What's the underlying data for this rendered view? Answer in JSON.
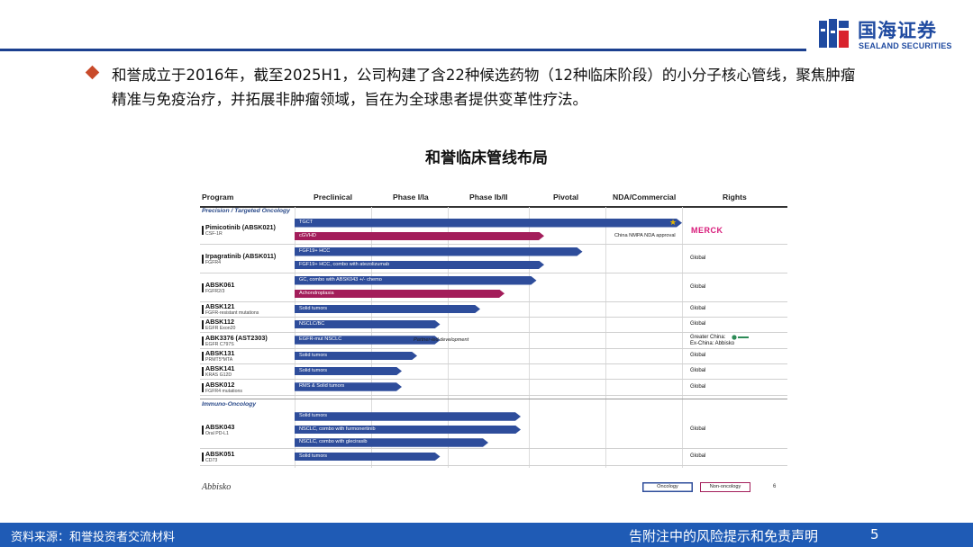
{
  "header": {
    "logo_cn": "国海证券",
    "logo_en": "SEALAND SECURITIES",
    "brand_color": "#1f4aa0"
  },
  "bullet": {
    "icon": "diamond-bullet",
    "line1": "和誉成立于2016年，截至2025H1，公司构建了含22种候选药物（12种临床阶段）的小分子核心管线，聚焦肿瘤",
    "line2": "精准与免疫治疗，并拓展非肿瘤领域，旨在为全球患者提供变革性疗法。"
  },
  "figure": {
    "title": "和誉临床管线布局",
    "headers": [
      "Program",
      "Preclinical",
      "Phase I/Ia",
      "Phase Ib/II",
      "Pivotal",
      "NDA/Commercial",
      "Rights"
    ],
    "sections": [
      "Precision / Targeted Oncology",
      "Immuno-Oncology"
    ],
    "programs": [
      {
        "name": "Pimicotinib (ABSK021)",
        "target": "CSF-1R",
        "rights": "",
        "merck": "MERCK",
        "bars": [
          {
            "label": "TGCT",
            "stage": 5.0,
            "type": "oncology"
          },
          {
            "label": "cGVHD",
            "stage": 3.2,
            "type": "non-oncology"
          }
        ],
        "note": "China NMPA NDA approval"
      },
      {
        "name": "Irpagratinib (ABSK011)",
        "target": "FGFR4",
        "rights": "Global",
        "bars": [
          {
            "label": "FGF19+ HCC",
            "stage": 3.7,
            "type": "oncology"
          },
          {
            "label": "FGF19+ HCC, combo with atezolizumab",
            "stage": 3.2,
            "type": "oncology"
          }
        ]
      },
      {
        "name": "ABSK061",
        "target": "FGFR2/3",
        "rights": "Global",
        "bars": [
          {
            "label": "GC, combo with ABSK043 +/- chemo",
            "stage": 3.1,
            "type": "oncology"
          },
          {
            "label": "Achondroplasia",
            "stage": 2.7,
            "type": "non-oncology"
          }
        ]
      },
      {
        "name": "ABSK121",
        "target": "FGFR-resistant mutations",
        "rights": "Global",
        "bars": [
          {
            "label": "Solid tumors",
            "stage": 2.4,
            "type": "oncology"
          }
        ]
      },
      {
        "name": "ABSK112",
        "target": "EGFR Exon20",
        "rights": "Global",
        "bars": [
          {
            "label": "NSCLC/BC",
            "stage": 1.9,
            "type": "oncology"
          }
        ]
      },
      {
        "name": "ABK3376 (AST2303)",
        "target": "EGFR C797S",
        "rights": "Greater China:",
        "rights2": "Ex-China:  Abbisko",
        "bars": [
          {
            "label": "EGFR-mut NSCLC",
            "stage": 1.9,
            "type": "oncology"
          }
        ],
        "note": "Partner-led development"
      },
      {
        "name": "ABSK131",
        "target": "PRMT5*MTA",
        "rights": "Global",
        "bars": [
          {
            "label": "Solid tumors",
            "stage": 1.6,
            "type": "oncology"
          }
        ]
      },
      {
        "name": "ABSK141",
        "target": "KRAS G12D",
        "rights": "Global",
        "bars": [
          {
            "label": "Solid tumors",
            "stage": 1.4,
            "type": "oncology"
          }
        ]
      },
      {
        "name": "ABSK012",
        "target": "FGFR4 mutations",
        "rights": "Global",
        "bars": [
          {
            "label": "RMS & Solid tumors",
            "stage": 1.4,
            "type": "oncology"
          }
        ]
      },
      {
        "name": "ABSK043",
        "target": "Oral PD-L1",
        "rights": "Global",
        "bars": [
          {
            "label": "Solid tumors",
            "stage": 2.9,
            "type": "oncology"
          },
          {
            "label": "NSCLC, combo with furmonertinib",
            "stage": 2.9,
            "type": "oncology"
          },
          {
            "label": "NSCLC, combo with glecirasib",
            "stage": 2.5,
            "type": "oncology"
          }
        ]
      },
      {
        "name": "ABSK051",
        "target": "CD73",
        "rights": "Global",
        "bars": [
          {
            "label": "Solid tumors",
            "stage": 1.9,
            "type": "oncology"
          }
        ]
      }
    ],
    "legend": {
      "oncology": "Oncology",
      "non_oncology": "Non-oncology"
    },
    "company_logo": "Abbisko",
    "inner_page": "6",
    "colors": {
      "oncology": "#2e4d9b",
      "non_oncology": "#a31d5a"
    }
  },
  "footer": {
    "source": "资料来源：和誉投资者交流材料",
    "disclaimer": "告附注中的风险提示和免责声明",
    "page": "5"
  }
}
